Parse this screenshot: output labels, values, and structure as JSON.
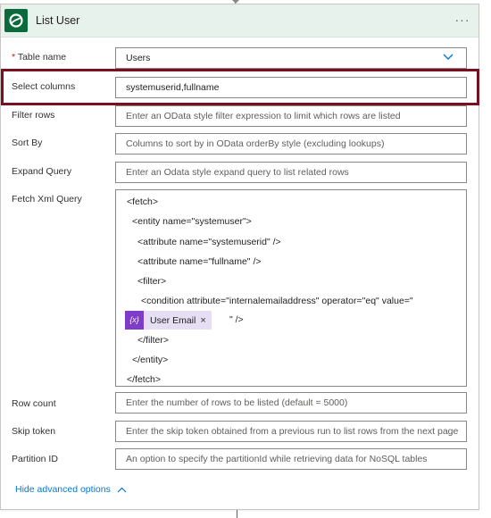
{
  "action": {
    "title": "List User",
    "more_label": "···",
    "brand_color": "#0b6a3c",
    "header_bg": "#e7f2ec"
  },
  "fields": {
    "table_name": {
      "label": "Table name",
      "required_mark": "*",
      "value": "Users"
    },
    "select_columns": {
      "label": "Select columns",
      "value": "systemuserid,fullname"
    },
    "filter_rows": {
      "label": "Filter rows",
      "placeholder": "Enter an OData style filter expression to limit which rows are listed"
    },
    "sort_by": {
      "label": "Sort By",
      "placeholder": "Columns to sort by in OData orderBy style (excluding lookups)"
    },
    "expand_query": {
      "label": "Expand Query",
      "placeholder": "Enter an Odata style expand query to list related rows"
    },
    "fetch_xml": {
      "label": "Fetch Xml Query",
      "lines": [
        "<fetch>",
        "<entity name=\"systemuser\">",
        "<attribute name=\"systemuserid\" />",
        "<attribute name=\"fullname\" />",
        "<filter>",
        "<condition attribute=\"internalemailaddress\" operator=\"eq\" value=\"",
        "</filter>",
        "</entity>",
        "</fetch>"
      ],
      "token": {
        "icon_text": "{x}",
        "label": "User Email",
        "close": "×",
        "after": "\" />",
        "color": "#7e3cc8"
      }
    },
    "row_count": {
      "label": "Row count",
      "placeholder": "Enter the number of rows to be listed (default = 5000)"
    },
    "skip_token": {
      "label": "Skip token",
      "placeholder": "Enter the skip token obtained from a previous run to list rows from the next page"
    },
    "partition_id": {
      "label": "Partition ID",
      "placeholder": "An option to specify the partitionId while retrieving data for NoSQL tables"
    }
  },
  "footer": {
    "hide_advanced_label": "Hide advanced options"
  },
  "highlight_color": "#7a1020"
}
